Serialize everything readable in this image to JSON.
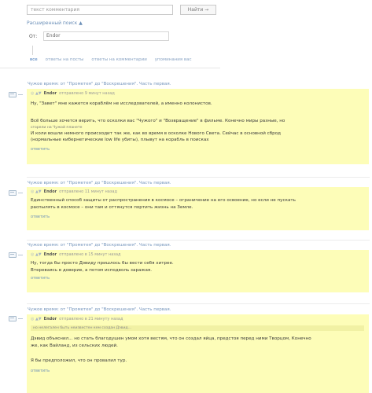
{
  "search": {
    "placeholder": "текст комментария",
    "button_label": "Найти →"
  },
  "advanced_search_label": "Расширенный поиск ▲",
  "filter": {
    "from_label": "От:",
    "from_value": "Endor"
  },
  "tabs": [
    "все",
    "ответы на посты",
    "ответы на комментарии",
    "упоминания вас"
  ],
  "threads": [
    {
      "title": "Чужое время: от \"Прометея\" до \"Воскрешения\". Часть первая.",
      "author": "Endor",
      "meta": "отправлено 9 минут назад",
      "text": "Ну, \"Завет\" мне кажется кораблём не исследователей, а именно колонистов.",
      "text2": "Всё больше хочется верить, что осколки вас \"Чужого\" и \"Возвращение\" в фильме. Конечно миры разные, но",
      "text3": "сгорели на Чужой планете",
      "text4": "И коли вошли немного происходит так же, как во время в осколке Нового Света. Сейчас в основной сброд",
      "text5": "(нормальные кибернетические low life убиты), плывут на корабль в поисках",
      "reply": "ответить"
    },
    {
      "title": "Чужое время: от \"Прометея\" до \"Воскрешения\". Часть первая.",
      "author": "Endor",
      "meta": "отправлено 11 минут назад",
      "text": "Единственный способ защиты от распространения в космосе – ограничение на его освоение, но если не пускать",
      "text2": "распылять в космосе – они там и оттянутся портить жизнь на Земле.",
      "reply": "ответить"
    },
    {
      "title": "Чужое время: от \"Прометея\" до \"Воскрешения\". Часть первая.",
      "author": "Endor",
      "meta": "отправлено в 15 минут назад",
      "text": "Ну, тогда бы просто Дэвиду пришлось бы вести себя хитрее.",
      "text2": "Втереваясь в доверие, а потом исподволь заражая.",
      "reply": "ответить"
    },
    {
      "title": "Чужое время: от \"Прометея\" до \"Воскрешения\". Часть первая.",
      "author": "Endor",
      "meta": "отправлено в 21 минуту назад",
      "quote": "но нелегален быть неизвестен кем создан Дэвид…",
      "text": "Дэвид объяснил... но стать благодушен умом хотя вестям, что он создал яйца, предстоя перед ними Творцом, Конечно",
      "text2": "же, как Вайланд, из сельских людей.",
      "text3": "Я бы предположил, что он провалил тур.",
      "reply": "ответить"
    }
  ]
}
